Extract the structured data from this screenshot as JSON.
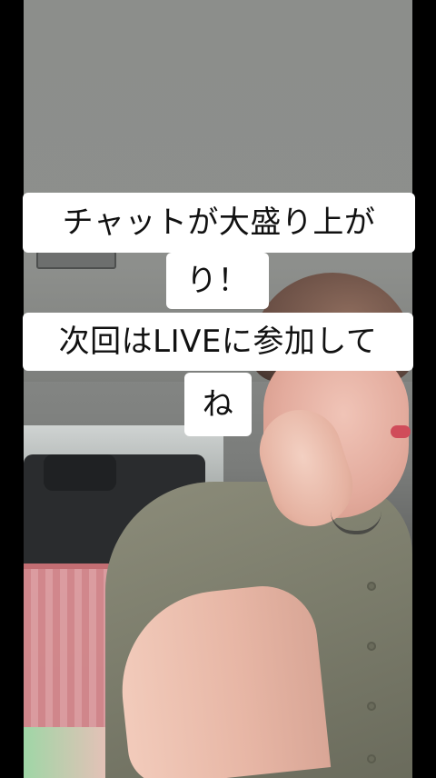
{
  "captions": {
    "line1": "チャットが大盛り上が",
    "line2": "り！",
    "line3": "次回はLIVEに参加して",
    "line4": "ね"
  },
  "colors": {
    "caption_background": "#ffffff",
    "caption_text": "#111111",
    "letterbox": "#000000"
  }
}
